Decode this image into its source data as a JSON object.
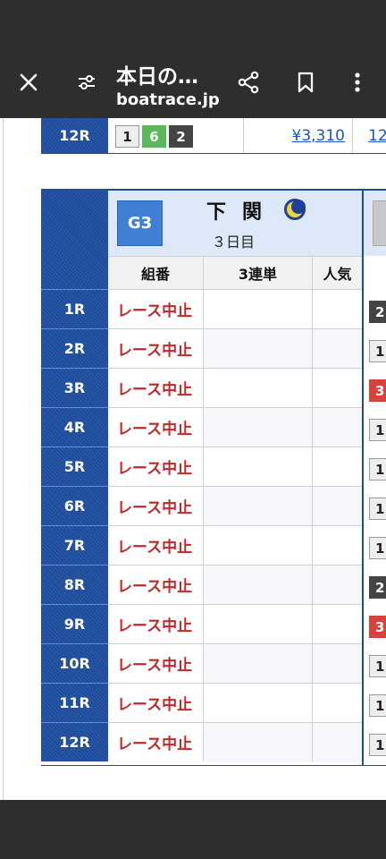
{
  "toolbar": {
    "title": "本日の…",
    "url": "boatrace.jp"
  },
  "top_row": {
    "race": "12R",
    "boats": [
      "1",
      "6",
      "2"
    ],
    "payout": "¥3,310",
    "popularity": "12"
  },
  "venue": {
    "grade": "G3",
    "name": "下関",
    "day": "３日目",
    "column_headers": [
      "組番",
      "3連単",
      "人気"
    ]
  },
  "races": [
    {
      "race": "1R",
      "status": "レース中止",
      "next_boat": "2",
      "next_color": "black"
    },
    {
      "race": "2R",
      "status": "レース中止",
      "next_boat": "1",
      "next_color": "white"
    },
    {
      "race": "3R",
      "status": "レース中止",
      "next_boat": "3",
      "next_color": "red"
    },
    {
      "race": "4R",
      "status": "レース中止",
      "next_boat": "1",
      "next_color": "white"
    },
    {
      "race": "5R",
      "status": "レース中止",
      "next_boat": "1",
      "next_color": "white"
    },
    {
      "race": "6R",
      "status": "レース中止",
      "next_boat": "1",
      "next_color": "white"
    },
    {
      "race": "7R",
      "status": "レース中止",
      "next_boat": "1",
      "next_color": "white"
    },
    {
      "race": "8R",
      "status": "レース中止",
      "next_boat": "2",
      "next_color": "black"
    },
    {
      "race": "9R",
      "status": "レース中止",
      "next_boat": "3",
      "next_color": "red"
    },
    {
      "race": "10R",
      "status": "レース中止",
      "next_boat": "1",
      "next_color": "white"
    },
    {
      "race": "11R",
      "status": "レース中止",
      "next_boat": "1",
      "next_color": "white"
    },
    {
      "race": "12R",
      "status": "レース中止",
      "next_boat": "1",
      "next_color": "white"
    }
  ],
  "icons": {
    "close": "close-icon",
    "tune": "tune-icon",
    "share": "share-icon",
    "bookmark": "bookmark-icon",
    "more": "more-vert-icon",
    "night_race": "moon-icon"
  },
  "colors": {
    "header_blue": "#1e4c9c",
    "cancel_red": "#c0282b",
    "link_blue": "#1a56c9"
  }
}
